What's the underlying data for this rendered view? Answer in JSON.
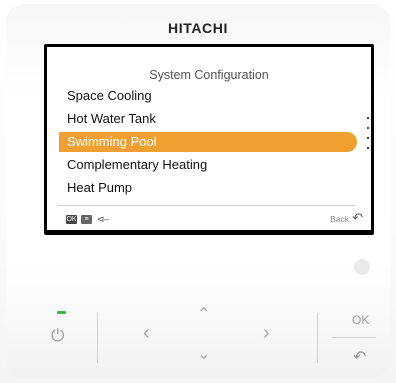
{
  "brand": "HITACHI",
  "screen": {
    "title": "System Configuration",
    "menu_items": [
      {
        "label": "Space Cooling",
        "selected": false
      },
      {
        "label": "Hot Water Tank",
        "selected": false
      },
      {
        "label": "Swimming Pool",
        "selected": true
      },
      {
        "label": "Complementary Heating",
        "selected": false
      },
      {
        "label": "Heat Pump",
        "selected": false
      }
    ],
    "footer": {
      "ok_icon": "ok-icon",
      "ok_text": "OK",
      "menu_icon": "menu-icon",
      "key_icon": "key-icon",
      "back_label": "Back",
      "back_icon": "return-icon"
    },
    "highlight_color": "#f0a030"
  },
  "buttons": {
    "ok_label": "OK",
    "led_color": "#38b44a"
  }
}
